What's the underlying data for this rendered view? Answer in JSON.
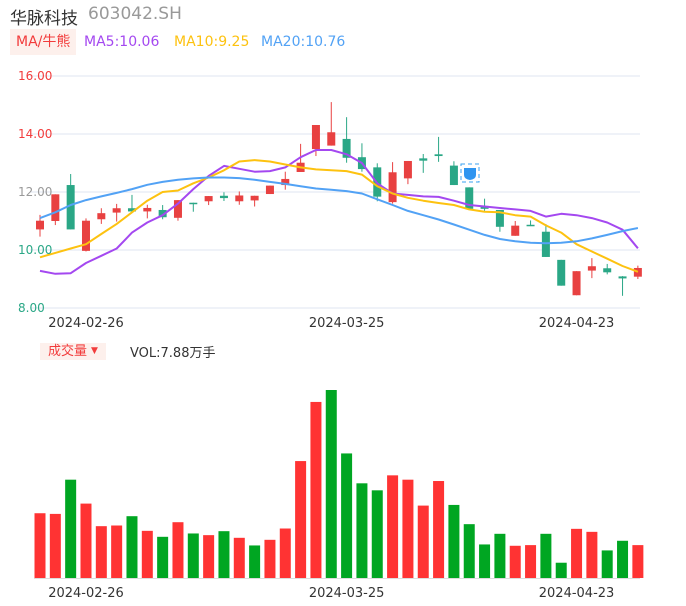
{
  "header": {
    "name": "华脉科技",
    "code": "603042.SH"
  },
  "ma_legend": {
    "tag": "MA/牛熊",
    "ma5": "MA5:10.06",
    "ma10": "MA10:9.25",
    "ma20": "MA20:10.76"
  },
  "volume_legend": {
    "tag": "成交量",
    "value": "VOL:7.88万手"
  },
  "colors": {
    "up": "#e84141",
    "down": "#2aa786",
    "vol_up": "#ff3333",
    "vol_down": "#00a622",
    "ma5": "#a448f0",
    "ma10": "#fdc210",
    "ma20": "#52a2f5",
    "grid": "#dfe5f0"
  },
  "chart_data": [
    {
      "type": "candlestick",
      "title": "华脉科技 603042.SH",
      "ylim": [
        8,
        16
      ],
      "y_ticks": [
        "16.00",
        "14.00",
        "12.00",
        "10.00",
        "8.00"
      ],
      "x_ticks": [
        {
          "index": 3,
          "label": "2024-02-26"
        },
        {
          "index": 20,
          "label": "2024-03-25"
        },
        {
          "index": 35,
          "label": "2024-04-23"
        }
      ],
      "ohlc": [
        [
          10.71,
          11.21,
          10.46,
          11.01
        ],
        [
          11.0,
          11.92,
          10.86,
          11.92
        ],
        [
          12.24,
          12.62,
          10.71,
          10.71
        ],
        [
          9.97,
          11.09,
          9.95,
          11.01
        ],
        [
          11.06,
          11.44,
          10.9,
          11.27
        ],
        [
          11.29,
          11.59,
          10.98,
          11.44
        ],
        [
          11.44,
          11.9,
          11.31,
          11.33
        ],
        [
          11.33,
          11.56,
          11.09,
          11.45
        ],
        [
          11.38,
          11.55,
          11.06,
          11.13
        ],
        [
          11.11,
          11.72,
          11.01,
          11.72
        ],
        [
          11.63,
          11.63,
          11.32,
          11.6
        ],
        [
          11.68,
          11.86,
          11.55,
          11.86
        ],
        [
          11.87,
          11.99,
          11.69,
          11.79
        ],
        [
          11.68,
          12.02,
          11.56,
          11.88
        ],
        [
          11.71,
          11.87,
          11.5,
          11.87
        ],
        [
          11.93,
          12.22,
          11.93,
          12.22
        ],
        [
          12.24,
          12.7,
          12.08,
          12.45
        ],
        [
          12.69,
          13.66,
          12.69,
          13.01
        ],
        [
          13.48,
          14.31,
          13.24,
          14.31
        ],
        [
          13.6,
          15.1,
          13.6,
          14.06
        ],
        [
          13.83,
          14.58,
          13.01,
          13.18
        ],
        [
          13.2,
          13.68,
          12.7,
          12.79
        ],
        [
          12.85,
          12.99,
          11.68,
          11.84
        ],
        [
          11.65,
          13.03,
          11.6,
          12.68
        ],
        [
          12.47,
          13.07,
          12.27,
          13.07
        ],
        [
          13.16,
          13.31,
          12.66,
          13.08
        ],
        [
          13.3,
          13.9,
          13.04,
          13.24
        ],
        [
          12.91,
          13.06,
          12.24,
          12.24
        ],
        [
          12.16,
          12.16,
          11.42,
          11.42
        ],
        [
          11.52,
          11.77,
          11.35,
          11.42
        ],
        [
          11.38,
          11.38,
          10.63,
          10.8
        ],
        [
          10.49,
          11.0,
          10.49,
          10.84
        ],
        [
          10.87,
          11.02,
          10.85,
          10.86
        ],
        [
          10.63,
          10.89,
          9.76,
          9.76
        ],
        [
          9.66,
          9.66,
          8.77,
          8.77
        ],
        [
          8.44,
          9.27,
          8.44,
          9.27
        ],
        [
          9.29,
          9.72,
          9.03,
          9.44
        ],
        [
          9.37,
          9.52,
          9.16,
          9.23
        ],
        [
          9.09,
          9.1,
          8.42,
          9.02
        ],
        [
          9.08,
          9.46,
          9.0,
          9.38
        ]
      ],
      "series": [
        {
          "name": "MA5",
          "values": [
            9.28,
            9.18,
            9.2,
            9.55,
            9.8,
            10.05,
            10.6,
            10.95,
            11.2,
            11.6,
            12.1,
            12.55,
            12.9,
            12.8,
            12.7,
            12.72,
            12.85,
            13.2,
            13.45,
            13.45,
            13.3,
            13.0,
            12.3,
            11.95,
            11.9,
            11.85,
            11.83,
            11.7,
            11.55,
            11.5,
            11.45,
            11.4,
            11.35,
            11.15,
            11.25,
            11.2,
            11.1,
            10.95,
            10.7,
            10.06
          ]
        },
        {
          "name": "MA10",
          "values": [
            9.75,
            9.9,
            10.05,
            10.2,
            10.55,
            10.9,
            11.3,
            11.7,
            12.0,
            12.05,
            12.3,
            12.5,
            12.75,
            13.05,
            13.1,
            13.05,
            12.95,
            12.85,
            12.78,
            12.75,
            12.72,
            12.6,
            12.2,
            11.95,
            11.8,
            11.7,
            11.62,
            11.55,
            11.4,
            11.32,
            11.3,
            11.2,
            11.15,
            10.85,
            10.6,
            10.2,
            9.95,
            9.7,
            9.45,
            9.25
          ]
        },
        {
          "name": "MA20",
          "values": [
            11.1,
            11.3,
            11.55,
            11.72,
            11.85,
            11.97,
            12.1,
            12.25,
            12.35,
            12.42,
            12.47,
            12.5,
            12.5,
            12.48,
            12.42,
            12.35,
            12.28,
            12.2,
            12.12,
            12.08,
            12.03,
            11.95,
            11.75,
            11.55,
            11.35,
            11.2,
            11.05,
            10.88,
            10.7,
            10.52,
            10.38,
            10.3,
            10.25,
            10.23,
            10.25,
            10.3,
            10.4,
            10.52,
            10.65,
            10.76
          ]
        }
      ]
    },
    {
      "type": "bar",
      "title": "成交量",
      "unit": "万手",
      "x_ticks": [
        {
          "index": 3,
          "label": "2024-02-26"
        },
        {
          "index": 20,
          "label": "2024-03-25"
        },
        {
          "index": 35,
          "label": "2024-04-23"
        }
      ],
      "values": [
        15.52,
        15.36,
        23.56,
        17.83,
        12.42,
        12.58,
        14.81,
        11.3,
        9.87,
        13.37,
        10.67,
        10.27,
        11.22,
        9.63,
        7.8,
        9.15,
        11.86,
        28.02,
        42.19,
        45.05,
        29.85,
        22.69,
        21.01,
        24.6,
        23.56,
        17.35,
        23.24,
        17.51,
        12.9,
        8.04,
        10.59,
        7.72,
        7.88,
        10.59,
        3.66,
        11.78,
        11.06,
        6.61,
        8.92,
        7.88
      ],
      "up": [
        1,
        1,
        0,
        1,
        1,
        1,
        0,
        1,
        0,
        1,
        0,
        1,
        0,
        1,
        0,
        1,
        1,
        1,
        1,
        0,
        0,
        0,
        0,
        1,
        1,
        1,
        1,
        0,
        0,
        0,
        0,
        1,
        1,
        0,
        0,
        1,
        1,
        0,
        0,
        1
      ]
    }
  ]
}
